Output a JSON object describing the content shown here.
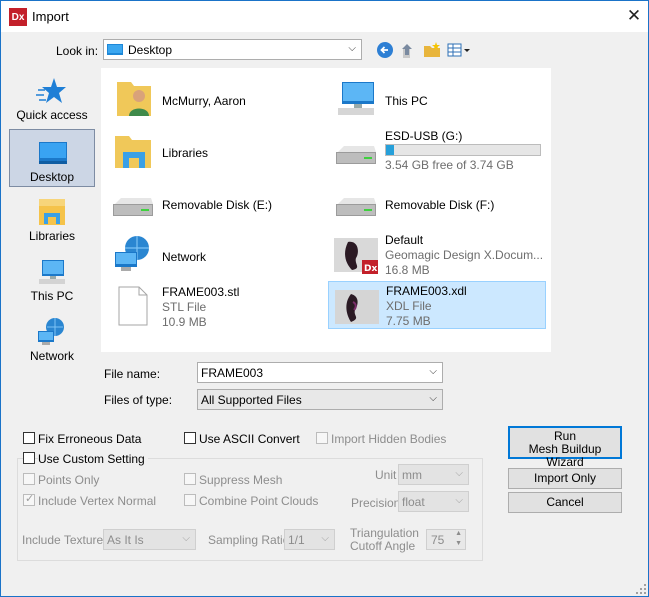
{
  "window": {
    "title": "Import",
    "app_icon_text": "Dx"
  },
  "toolbar": {
    "look_in_label": "Look in:",
    "look_in_value": "Desktop",
    "icons": [
      "back-icon",
      "up-folder-icon",
      "new-folder-icon",
      "view-menu-icon"
    ]
  },
  "places": [
    {
      "label": "Quick access",
      "icon": "quick-access-star-icon"
    },
    {
      "label": "Desktop",
      "icon": "desktop-icon"
    },
    {
      "label": "Libraries",
      "icon": "libraries-icon"
    },
    {
      "label": "This PC",
      "icon": "this-pc-icon"
    },
    {
      "label": "Network",
      "icon": "network-icon"
    }
  ],
  "items": {
    "mcmurry": {
      "name": "McMurry, Aaron"
    },
    "thispc": {
      "name": "This PC"
    },
    "libraries": {
      "name": "Libraries"
    },
    "esd": {
      "name": "ESD-USB (G:)",
      "free": "3.54 GB free of 3.74 GB",
      "used_fraction": 0.05
    },
    "diske": {
      "name": "Removable Disk (E:)"
    },
    "diskf": {
      "name": "Removable Disk (F:)"
    },
    "network": {
      "name": "Network"
    },
    "default": {
      "name": "Default",
      "type": "Geomagic Design X.Docum...",
      "size": "16.8 MB"
    },
    "stl": {
      "name": "FRAME003.stl",
      "type": "STL File",
      "size": "10.9 MB"
    },
    "xdl": {
      "name": "FRAME003.xdl",
      "type": "XDL File",
      "size": "7.75 MB"
    }
  },
  "file_name": {
    "label": "File name:",
    "value": "FRAME003"
  },
  "file_type": {
    "label": "Files of type:",
    "value": "All Supported Files"
  },
  "options": {
    "fix_erroneous": "Fix Erroneous Data",
    "use_ascii": "Use ASCII Convert",
    "import_hidden": "Import Hidden Bodies",
    "use_custom": "Use Custom Setting",
    "points_only": "Points Only",
    "suppress_mesh": "Suppress Mesh",
    "include_vertex_normal": "Include Vertex Normal",
    "combine_point_clouds": "Combine Point Clouds",
    "unit_label": "Unit",
    "unit_value": "mm",
    "precision_label": "Precision",
    "precision_value": "float",
    "include_texture_label": "Include Texture",
    "include_texture_value": "As It Is",
    "sampling_ratio_label": "Sampling Ratio",
    "sampling_ratio_value": "1/1",
    "triangulation_line1": "Triangulation",
    "triangulation_line2": "Cutoff Angle",
    "triangulation_value": "75"
  },
  "buttons": {
    "run_line1": "Run",
    "run_line2": "Mesh Buildup Wizard",
    "import_only": "Import Only",
    "cancel": "Cancel"
  }
}
